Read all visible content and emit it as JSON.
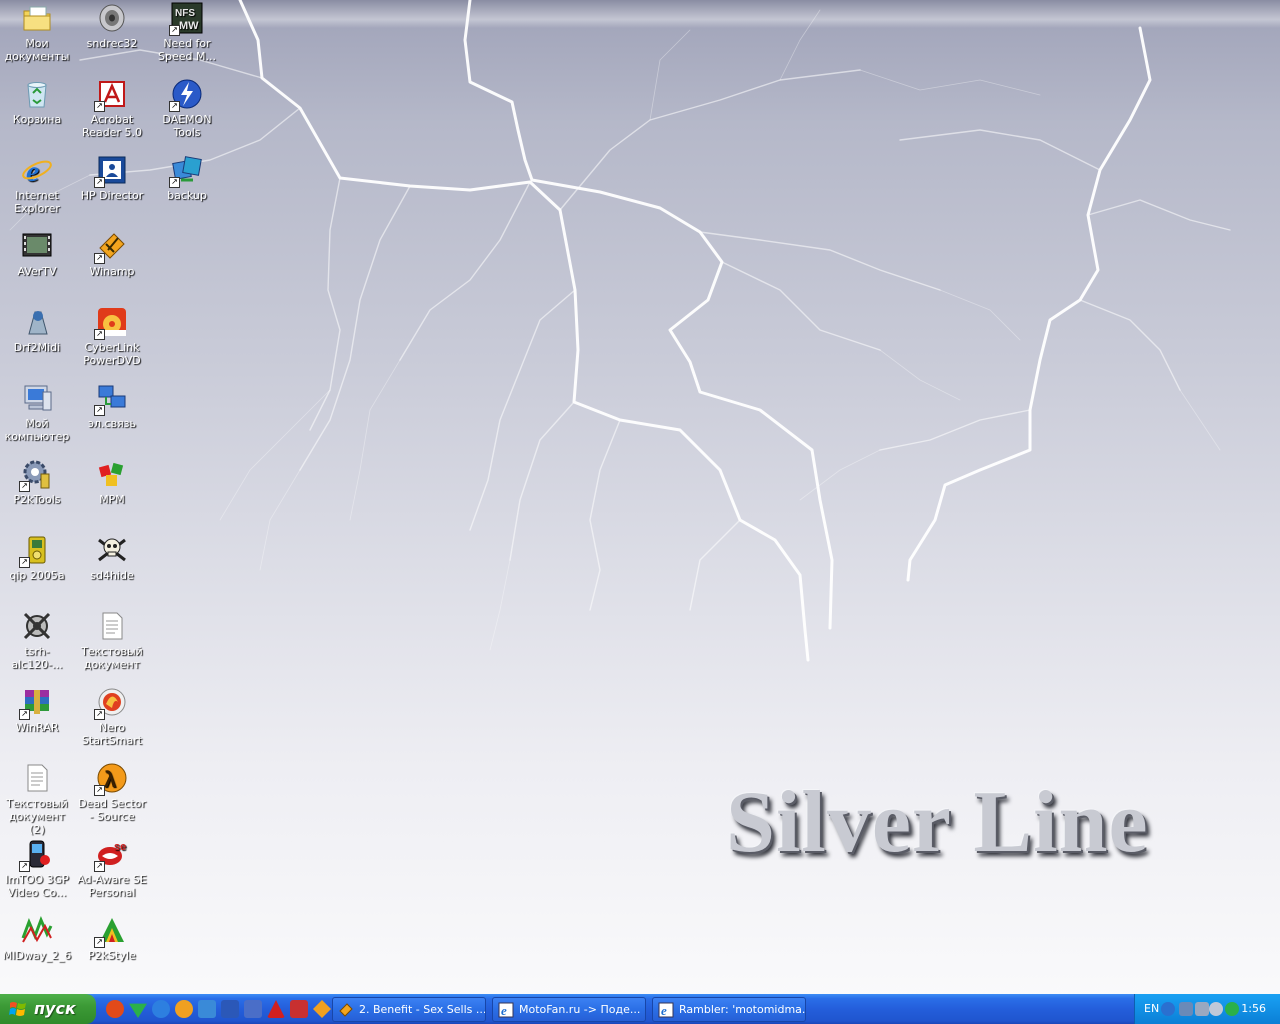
{
  "wallpaper": {
    "title": "Silver Line"
  },
  "desktop_icons": [
    {
      "label": "Мои документы",
      "icon": "folder-documents-icon",
      "shortcut": false
    },
    {
      "label": "sndrec32",
      "icon": "speaker-icon",
      "shortcut": false
    },
    {
      "label": "Need for Speed M...",
      "icon": "nfs-game-icon",
      "shortcut": true
    },
    {
      "label": "Корзина",
      "icon": "recycle-bin-icon",
      "shortcut": false
    },
    {
      "label": "Acrobat Reader 5.0",
      "icon": "acrobat-icon",
      "shortcut": true
    },
    {
      "label": "DAEMON Tools",
      "icon": "daemon-tools-icon",
      "shortcut": true
    },
    {
      "label": "Internet Explorer",
      "icon": "internet-explorer-icon",
      "shortcut": false
    },
    {
      "label": "HP Director",
      "icon": "hp-director-icon",
      "shortcut": true
    },
    {
      "label": "backup",
      "icon": "backup-icon",
      "shortcut": true
    },
    {
      "label": "AVerTV",
      "icon": "avertv-icon",
      "shortcut": false
    },
    {
      "label": "Winamp",
      "icon": "winamp-icon",
      "shortcut": true
    },
    {
      "label": "Drf2Midi",
      "icon": "drf2midi-icon",
      "shortcut": false
    },
    {
      "label": "CyberLink PowerDVD",
      "icon": "powerdvd-icon",
      "shortcut": true
    },
    {
      "label": "Мой компьютер",
      "icon": "my-computer-icon",
      "shortcut": false
    },
    {
      "label": "эл.связь",
      "icon": "network-connection-icon",
      "shortcut": true
    },
    {
      "label": "P2kTools",
      "icon": "p2ktools-icon",
      "shortcut": true
    },
    {
      "label": "MPM",
      "icon": "mpm-cubes-icon",
      "shortcut": false
    },
    {
      "label": "qip 2005a",
      "icon": "qip-icon",
      "shortcut": true
    },
    {
      "label": "sd4hide",
      "icon": "skull-crossbones-icon",
      "shortcut": false
    },
    {
      "label": "tsrh-alc120-...",
      "icon": "tsrh-icon",
      "shortcut": false
    },
    {
      "label": "Текстовый документ",
      "icon": "text-document-icon",
      "shortcut": false
    },
    {
      "label": "WinRAR",
      "icon": "winrar-icon",
      "shortcut": true
    },
    {
      "label": "Nero StartSmart",
      "icon": "nero-icon",
      "shortcut": true
    },
    {
      "label": "Текстовый документ (2)",
      "icon": "text-document-icon",
      "shortcut": false
    },
    {
      "label": "Dead Sector - Source",
      "icon": "half-life-icon",
      "shortcut": true
    },
    {
      "label": "ImTOO 3GP Video Co...",
      "icon": "imtoo-phone-icon",
      "shortcut": true
    },
    {
      "label": "Ad-Aware SE Personal",
      "icon": "ad-aware-icon",
      "shortcut": true
    },
    {
      "label": "MIDway_2_6",
      "icon": "midway-icon",
      "shortcut": false
    },
    {
      "label": "P2kStyle",
      "icon": "p2kstyle-icon",
      "shortcut": true
    }
  ],
  "taskbar": {
    "start_label": "пуск",
    "quick_launch": [
      {
        "icon": "qip-at-icon",
        "color": "#e24a1a"
      },
      {
        "icon": "green-arrow-icon",
        "color": "#2bb04a"
      },
      {
        "icon": "internet-explorer-icon",
        "color": "#2d7fe0"
      },
      {
        "icon": "media-player-icon",
        "color": "#f0a020"
      },
      {
        "icon": "outlook-express-icon",
        "color": "#3a8ad8"
      },
      {
        "icon": "word-icon",
        "color": "#2b58b8"
      },
      {
        "icon": "desktop-show-icon",
        "color": "#4a6ec8"
      },
      {
        "icon": "acrobat-icon",
        "color": "#d02020"
      },
      {
        "icon": "nokia-icon",
        "color": "#c83030"
      },
      {
        "icon": "winamp-icon",
        "color": "#f0a020"
      }
    ],
    "tasks": [
      {
        "label": "2. Benefit - Sex Sells ...",
        "icon": "winamp-icon"
      },
      {
        "label": "MotoFan.ru -> Поде...",
        "icon": "internet-explorer-icon"
      },
      {
        "label": "Rambler: 'motomidma...",
        "icon": "internet-explorer-icon"
      }
    ],
    "tray": {
      "language": "EN",
      "clock": "1:56",
      "icons": [
        "tray-expand-icon",
        "network-tray-icon",
        "monitor-tray-icon",
        "speaker-tray-icon",
        "qip-tray-icon"
      ]
    }
  }
}
